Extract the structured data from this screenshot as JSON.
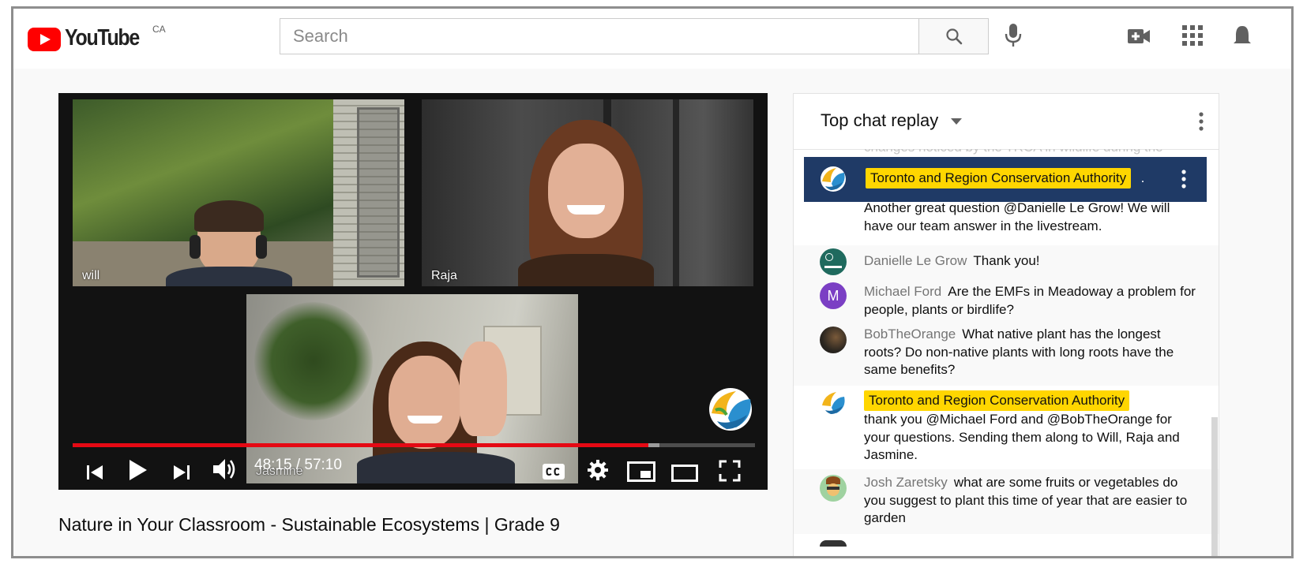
{
  "masthead": {
    "logo_text": "YouTube",
    "country": "CA",
    "search_placeholder": "Search"
  },
  "video": {
    "participants": [
      "will",
      "Raja",
      "Jasmine"
    ],
    "time": "48:15 / 57:10",
    "progress_played": 0.844,
    "progress_loaded": 0.86,
    "title": "Nature in Your Classroom - Sustainable Ecosystems | Grade 9"
  },
  "chat": {
    "mode_label": "Top chat replay",
    "cut_off_text": "changes noticed by the TRCA in wildlife during the",
    "pinned": {
      "author": "Toronto and Region Conservation Authority",
      "trailing": "."
    },
    "messages": [
      {
        "author": "",
        "text": "Another great question @Danielle Le Grow! We will have our team answer in the livestream."
      },
      {
        "author": "Danielle Le Grow",
        "text": "Thank you!"
      },
      {
        "author": "Michael Ford",
        "text": "Are the EMFs in Meadoway a problem for people, plants or birdlife?",
        "initial": "M"
      },
      {
        "author": "BobTheOrange",
        "text": "What native plant has the longest roots? Do non-native plants with long roots have the same benefits?"
      },
      {
        "author": "Toronto and Region Conservation Authority",
        "text": "thank you @Michael Ford and @BobTheOrange for your questions. Sending them along to Will, Raja and Jasmine."
      },
      {
        "author": "Josh Zaretsky",
        "text": "what are some fruits or vegetables do you suggest to plant this time of year that are easier to garden"
      }
    ]
  },
  "colors": {
    "brand_red": "#ff0000",
    "progress_red": "#e50914",
    "owner_badge": "#ffd600",
    "pinned_bg": "#1f3a66",
    "michael_avatar": "#7b3fc4"
  }
}
